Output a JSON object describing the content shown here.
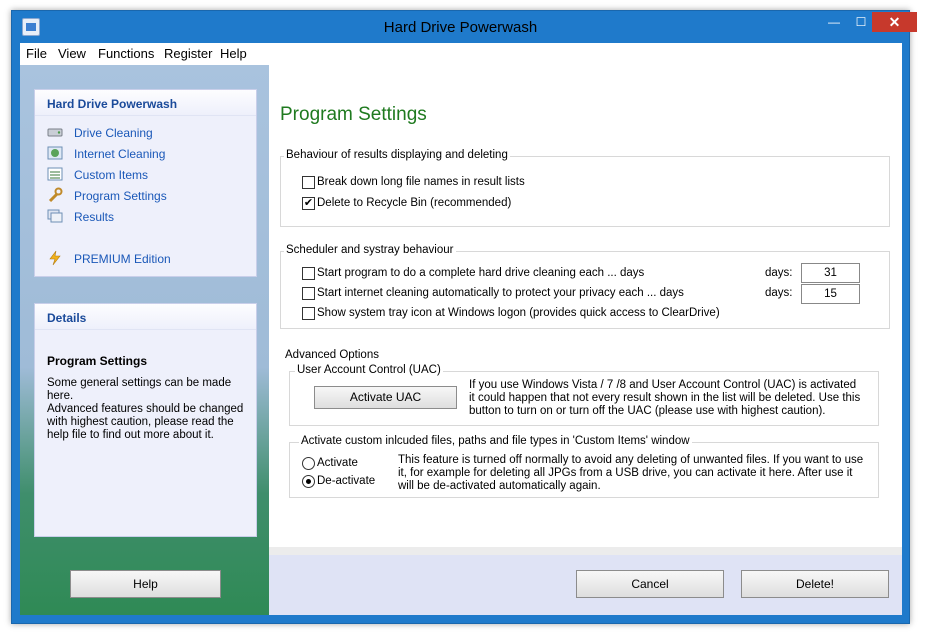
{
  "window": {
    "title": "Hard Drive Powerwash"
  },
  "menu": [
    "File",
    "View",
    "Functions",
    "Register",
    "Help"
  ],
  "nav": {
    "header": "Hard Drive Powerwash",
    "items": [
      {
        "label": "Drive Cleaning",
        "icon": "drive-icon"
      },
      {
        "label": "Internet Cleaning",
        "icon": "globe-icon"
      },
      {
        "label": "Custom Items",
        "icon": "list-icon"
      },
      {
        "label": "Program Settings",
        "icon": "wrench-icon"
      },
      {
        "label": "Results",
        "icon": "results-icon"
      }
    ],
    "premium": {
      "label": "PREMIUM Edition",
      "icon": "lightning-icon"
    }
  },
  "details": {
    "header": "Details",
    "title": "Program Settings",
    "p1": "Some general settings can be made here.",
    "p2": "Advanced features should be changed with highest caution, please read the help file to find out more about it."
  },
  "main": {
    "title": "Program Settings",
    "behaviour": {
      "legend": "Behaviour of results displaying and deleting",
      "break_down_label": "Break down long file names in result lists",
      "break_down_checked": false,
      "recycle_label": "Delete to Recycle Bin (recommended)",
      "recycle_checked": true
    },
    "scheduler": {
      "legend": "Scheduler and systray behaviour",
      "drive_label": "Start program to do a complete hard drive cleaning each ... days",
      "drive_days_label": "days:",
      "drive_days": "31",
      "internet_label": "Start internet cleaning automatically to protect your privacy each ... days",
      "internet_days_label": "days:",
      "internet_days": "15",
      "tray_label": "Show system tray icon at Windows logon (provides quick access to ClearDrive)"
    },
    "advanced": {
      "legend": "Advanced Options",
      "uac_legend": "User Account Control (UAC)",
      "uac_button": "Activate UAC",
      "uac_info": "If you use Windows Vista / 7 /8 and User Account Control (UAC) is activated it could happen that not every result shown in the list will be deleted. Use this button to turn on or turn off the UAC (please use with highest caution).",
      "custom_legend": "Activate custom inlcuded files, paths and file types in 'Custom Items' window",
      "activate_label": "Activate",
      "deactivate_label": "De-activate",
      "selected": "De-activate",
      "custom_info": "This feature is turned off normally to avoid any deleting of unwanted files. If you want to use it, for example for deleting all JPGs from a USB drive, you can activate it here. After use it will be de-activated automatically again."
    }
  },
  "footer": {
    "help": "Help",
    "cancel": "Cancel",
    "delete": "Delete!"
  },
  "colors": {
    "title_green": "#1f7a1f",
    "nav_link": "#1a58b8",
    "frame_blue": "#1f7acb",
    "close_red": "#c7392c"
  }
}
